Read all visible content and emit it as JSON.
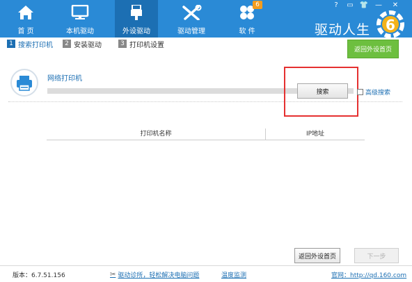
{
  "nav": {
    "items": [
      {
        "label": "首 页",
        "icon": "home-icon"
      },
      {
        "label": "本机驱动",
        "icon": "monitor-icon"
      },
      {
        "label": "外设驱动",
        "icon": "usb-icon"
      },
      {
        "label": "驱动管理",
        "icon": "tools-icon"
      },
      {
        "label": "软 件",
        "icon": "apps-icon"
      }
    ],
    "active_index": 2,
    "software_badge": "6"
  },
  "window_controls": [
    "?",
    "▭",
    "👕",
    "—",
    "✕"
  ],
  "brand": {
    "title": "驱动人生",
    "logo_text": "6"
  },
  "steps": [
    {
      "num": "1",
      "label": "搜索打印机"
    },
    {
      "num": "2",
      "label": "安装驱动"
    },
    {
      "num": "3",
      "label": "打印机设置"
    }
  ],
  "top_back_button": "返回外设首页",
  "search": {
    "network_label": "网络打印机",
    "progress": 0,
    "search_button": "搜索",
    "advanced_label": "高级搜索",
    "advanced_checked": false
  },
  "table": {
    "columns": [
      "打印机名称",
      "IP地址"
    ],
    "rows": []
  },
  "bottom_buttons": {
    "back": "返回外设首页",
    "next": "下一步"
  },
  "footer": {
    "version": "版本：6.7.51.156",
    "diag": "驱动诊所，轻松解决电脑问题",
    "temp": "温度监测",
    "site": "官网：http://qd.160.com"
  },
  "colors": {
    "topbar": "#2a8ad6",
    "active_tab": "#1c6fb3",
    "green_button": "#6dbf3f",
    "badge": "#f39c1d",
    "highlight_box": "#e53030"
  }
}
